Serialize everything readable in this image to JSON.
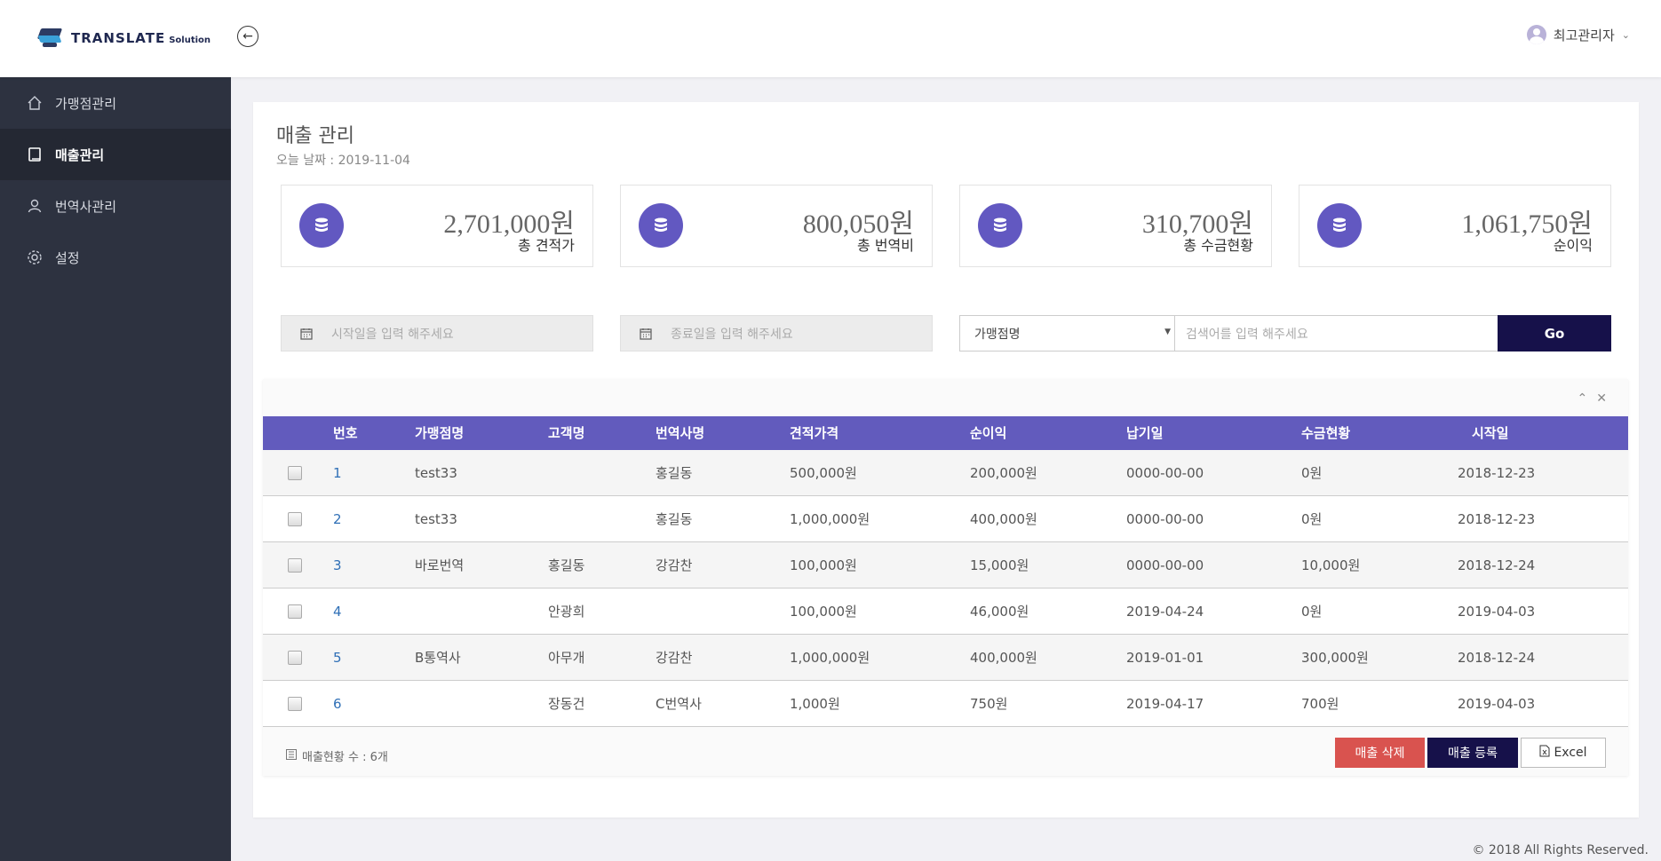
{
  "header": {
    "logo_text": "TRANSLATE",
    "logo_sub": "Solution",
    "user_name": "최고관리자"
  },
  "sidebar": {
    "items": [
      {
        "label": "가맹점관리",
        "icon": "home-icon"
      },
      {
        "label": "매출관리",
        "icon": "book-icon",
        "active": true
      },
      {
        "label": "번역사관리",
        "icon": "user-icon"
      },
      {
        "label": "설정",
        "icon": "gear-icon"
      }
    ]
  },
  "page": {
    "title": "매출 관리",
    "date_label": "오늘 날짜 : 2019-11-04"
  },
  "stats": [
    {
      "value": "2,701,000원",
      "label": "총 견적가"
    },
    {
      "value": "800,050원",
      "label": "총 번역비"
    },
    {
      "value": "310,700원",
      "label": "총 수금현황"
    },
    {
      "value": "1,061,750원",
      "label": "순이익"
    }
  ],
  "filters": {
    "start_placeholder": "시작일을 입력 해주세요",
    "end_placeholder": "종료일을 입력 해주세요",
    "select_value": "가맹점명",
    "search_placeholder": "검색어를 입력 해주세요",
    "go_label": "Go"
  },
  "table": {
    "columns": [
      "번호",
      "가맹점명",
      "고객명",
      "번역사명",
      "견적가격",
      "순이익",
      "납기일",
      "수금현황",
      "시작일"
    ],
    "rows": [
      [
        "1",
        "test33",
        "",
        "홍길동",
        "500,000원",
        "200,000원",
        "0000-00-00",
        "0원",
        "2018-12-23"
      ],
      [
        "2",
        "test33",
        "",
        "홍길동",
        "1,000,000원",
        "400,000원",
        "0000-00-00",
        "0원",
        "2018-12-23"
      ],
      [
        "3",
        "바로번역",
        "홍길동",
        "강감찬",
        "100,000원",
        "15,000원",
        "0000-00-00",
        "10,000원",
        "2018-12-24"
      ],
      [
        "4",
        "",
        "안광희",
        "",
        "100,000원",
        "46,000원",
        "2019-04-24",
        "0원",
        "2019-04-03"
      ],
      [
        "5",
        "B통역사",
        "아무개",
        "강감찬",
        "1,000,000원",
        "400,000원",
        "2019-01-01",
        "300,000원",
        "2018-12-24"
      ],
      [
        "6",
        "",
        "장동건",
        "C번역사",
        "1,000원",
        "750원",
        "2019-04-17",
        "700원",
        "2019-04-03"
      ]
    ],
    "count_label": "매출현황 수 : 6개"
  },
  "actions": {
    "delete_label": "매출 삭제",
    "register_label": "매출 등록",
    "excel_label": "Excel"
  },
  "footer": {
    "copyright": "© 2018 All Rights Reserved."
  },
  "colors": {
    "accent": "#625bbd",
    "navy": "#16114a",
    "sidebar": "#2d3240",
    "danger": "#d9534f"
  }
}
